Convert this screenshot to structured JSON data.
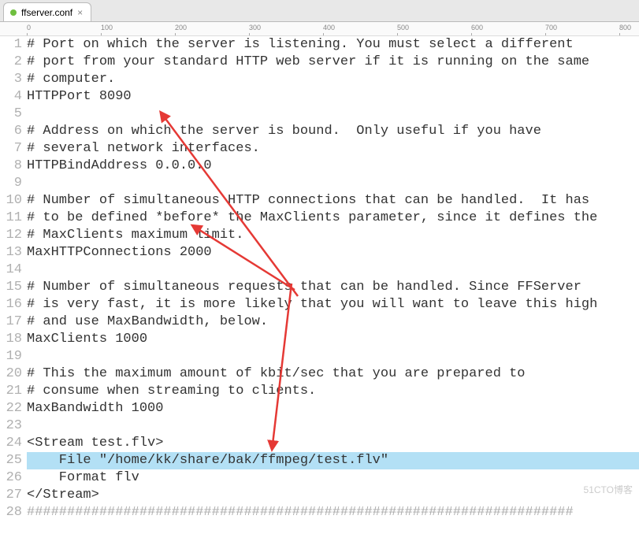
{
  "tab": {
    "filename": "ffserver.conf",
    "close_symbol": "×"
  },
  "ruler": {
    "marks": [
      {
        "label": "0",
        "pos": 34
      },
      {
        "label": "100",
        "pos": 128
      },
      {
        "label": "200",
        "pos": 222
      },
      {
        "label": "300",
        "pos": 316
      },
      {
        "label": "400",
        "pos": 410
      },
      {
        "label": "500",
        "pos": 504
      },
      {
        "label": "600",
        "pos": 598
      },
      {
        "label": "700",
        "pos": 692
      },
      {
        "label": "800",
        "pos": 786
      }
    ]
  },
  "code": {
    "lines": [
      {
        "n": 1,
        "text": "# Port on which the server is listening. You must select a different"
      },
      {
        "n": 2,
        "text": "# port from your standard HTTP web server if it is running on the same"
      },
      {
        "n": 3,
        "text": "# computer."
      },
      {
        "n": 4,
        "text": "HTTPPort 8090"
      },
      {
        "n": 5,
        "text": ""
      },
      {
        "n": 6,
        "text": "# Address on which the server is bound.  Only useful if you have"
      },
      {
        "n": 7,
        "text": "# several network interfaces."
      },
      {
        "n": 8,
        "text": "HTTPBindAddress 0.0.0.0"
      },
      {
        "n": 9,
        "text": ""
      },
      {
        "n": 10,
        "text": "# Number of simultaneous HTTP connections that can be handled.  It has"
      },
      {
        "n": 11,
        "text": "# to be defined *before* the MaxClients parameter, since it defines the"
      },
      {
        "n": 12,
        "text": "# MaxClients maximum limit."
      },
      {
        "n": 13,
        "text": "MaxHTTPConnections 2000"
      },
      {
        "n": 14,
        "text": ""
      },
      {
        "n": 15,
        "text": "# Number of simultaneous requests that can be handled. Since FFServer"
      },
      {
        "n": 16,
        "text": "# is very fast, it is more likely that you will want to leave this high"
      },
      {
        "n": 17,
        "text": "# and use MaxBandwidth, below."
      },
      {
        "n": 18,
        "text": "MaxClients 1000"
      },
      {
        "n": 19,
        "text": ""
      },
      {
        "n": 20,
        "text": "# This the maximum amount of kbit/sec that you are prepared to"
      },
      {
        "n": 21,
        "text": "# consume when streaming to clients."
      },
      {
        "n": 22,
        "text": "MaxBandwidth 1000"
      },
      {
        "n": 23,
        "text": ""
      },
      {
        "n": 24,
        "text": "<Stream test.flv>"
      },
      {
        "n": 25,
        "text": "    File \"/home/kk/share/bak/ffmpeg/test.flv\"",
        "highlight": true
      },
      {
        "n": 26,
        "text": "    Format flv"
      },
      {
        "n": 27,
        "text": "</Stream>"
      },
      {
        "n": 28,
        "text": "####################################################################",
        "faint": true
      }
    ]
  },
  "watermark": "51CTO博客",
  "arrows": {
    "color": "#e53935"
  }
}
